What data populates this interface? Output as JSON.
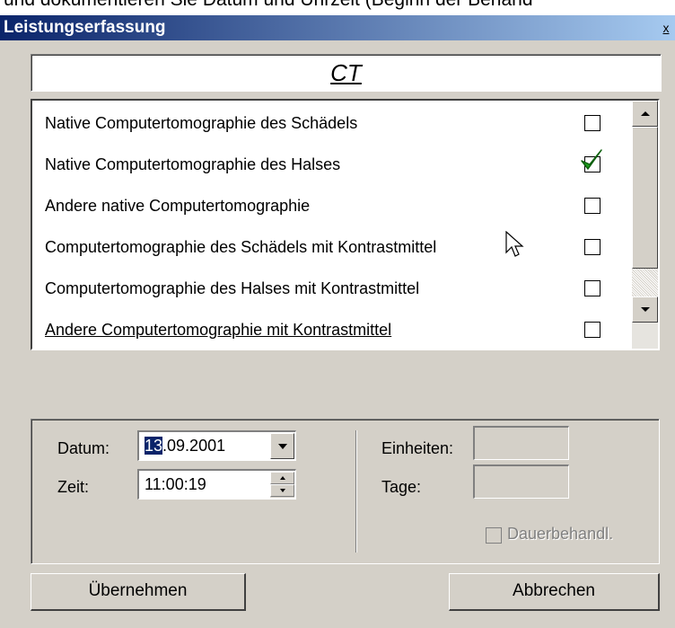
{
  "background_text": "und dokumentieren Sie Datum und Uhrzeit (Beginn der Behand",
  "window": {
    "title": "Leistungserfassung",
    "close_label": "x"
  },
  "category": "CT",
  "procedures": [
    {
      "label": "Native Computertomographie des Schädels",
      "checked": false
    },
    {
      "label": "Native Computertomographie des Halses",
      "checked": true
    },
    {
      "label": "Andere native Computertomographie",
      "checked": false
    },
    {
      "label": "Computertomographie des Schädels mit Kontrastmittel",
      "checked": false
    },
    {
      "label": "Computertomographie des Halses mit Kontrastmittel",
      "checked": false
    },
    {
      "label": "Andere Computertomographie mit Kontrastmittel",
      "checked": false
    }
  ],
  "form": {
    "date_label": "Datum:",
    "date_selected_part": "13",
    "date_rest": ".09.2001",
    "time_label": "Zeit:",
    "time_value": "11:00:19",
    "units_label": "Einheiten:",
    "days_label": "Tage:",
    "long_term_label": "Dauerbehandl."
  },
  "buttons": {
    "apply": "Übernehmen",
    "cancel": "Abbrechen"
  },
  "colors": {
    "titlebar_start": "#0a246a",
    "titlebar_end": "#a6caf0",
    "dialog_bg": "#d4d0c8",
    "check_green": "#1a9a1a"
  }
}
